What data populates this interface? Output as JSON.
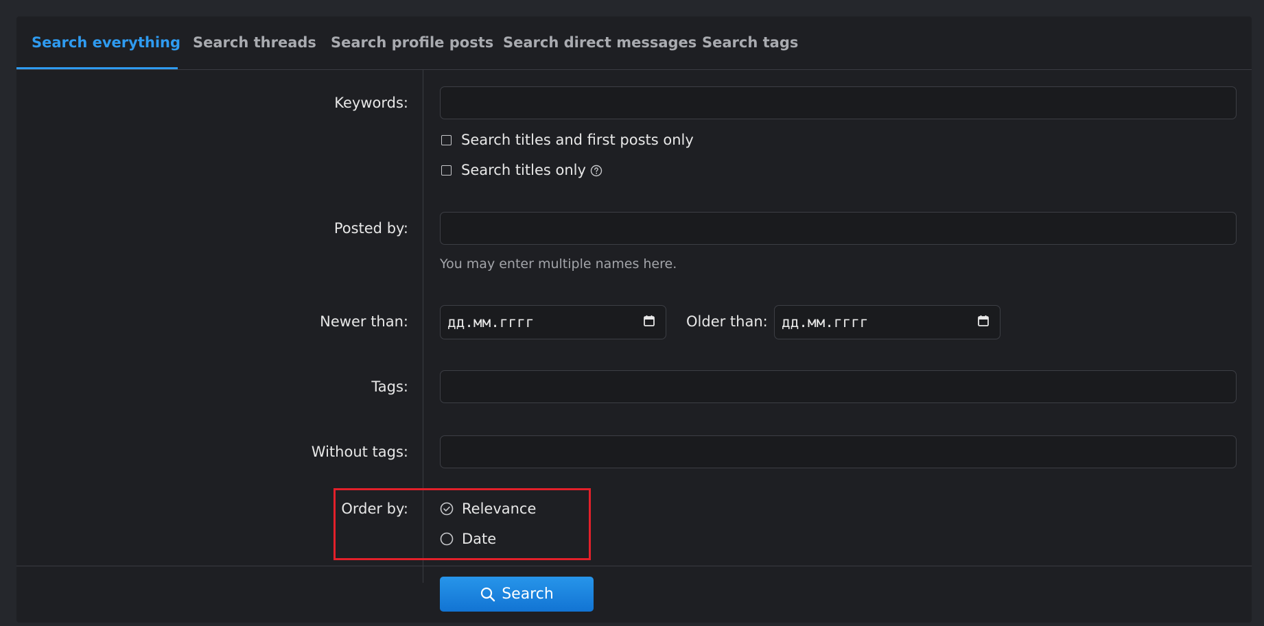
{
  "tabs": [
    {
      "label": "Search everything",
      "active": true
    },
    {
      "label": "Search threads",
      "active": false
    },
    {
      "label": "Search profile posts",
      "active": false
    },
    {
      "label": "Search direct messages",
      "active": false
    },
    {
      "label": "Search tags",
      "active": false
    }
  ],
  "form": {
    "keywords": {
      "label": "Keywords:",
      "value": "",
      "options": [
        {
          "label": "Search titles and first posts only",
          "checked": false
        },
        {
          "label": "Search titles only",
          "checked": false,
          "help_icon": "question-circle-icon"
        }
      ]
    },
    "posted_by": {
      "label": "Posted by:",
      "value": "",
      "hint": "You may enter multiple names here."
    },
    "newer_than": {
      "label": "Newer than:",
      "placeholder": "дд.мм.гггг",
      "icon": "calendar-icon"
    },
    "older_than": {
      "label": "Older than:",
      "placeholder": "дд.мм.гггг",
      "icon": "calendar-icon"
    },
    "tags": {
      "label": "Tags:",
      "value": ""
    },
    "without_tags": {
      "label": "Without tags:",
      "value": ""
    },
    "order_by": {
      "label": "Order by:",
      "options": [
        {
          "label": "Relevance",
          "selected": true
        },
        {
          "label": "Date",
          "selected": false
        }
      ]
    }
  },
  "submit": {
    "label": "Search",
    "icon": "search-icon"
  },
  "colors": {
    "accent": "#2f9bf0",
    "highlight": "#e3202a",
    "background": "#1e1f23"
  }
}
